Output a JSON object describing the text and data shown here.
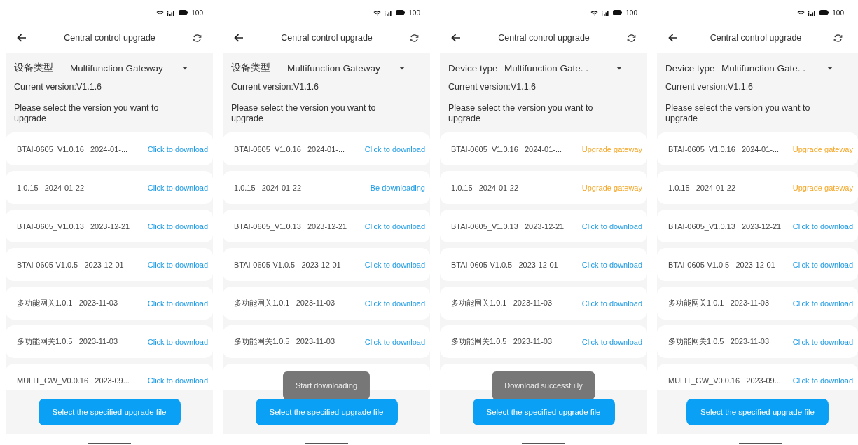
{
  "screens": [
    {
      "status_bar": {
        "battery": "100"
      },
      "title": "Central control upgrade",
      "device_label": "设备类型",
      "device_value": "Multifunction Gateway",
      "current_version": "Current version:V1.1.6",
      "prompt": "Please select the version you want to upgrade",
      "rows": [
        {
          "name": "BTAI-0605_V1.0.16   2024-01-...",
          "action": "Click to download",
          "kind": "download"
        },
        {
          "name": "1.0.15   2024-01-22",
          "action": "Click to download",
          "kind": "download"
        },
        {
          "name": "BTAI-0605_V1.0.13   2023-12-21",
          "action": "Click to download",
          "kind": "download"
        },
        {
          "name": "BTAI-0605-V1.0.5   2023-12-01",
          "action": "Click to download",
          "kind": "download"
        },
        {
          "name": "多功能网关1.0.1   2023-11-03",
          "action": "Click to download",
          "kind": "download"
        },
        {
          "name": "多功能网关1.0.5   2023-11-03",
          "action": "Click to download",
          "kind": "download"
        },
        {
          "name": "MULIT_GW_V0.0.16   2023-09...",
          "action": "Click to download",
          "kind": "download"
        }
      ],
      "button": "Select the specified upgrade file"
    },
    {
      "status_bar": {
        "battery": "100"
      },
      "title": "Central control upgrade",
      "device_label": "设备类型",
      "device_value": "Multifunction Gateway",
      "current_version": "Current version:V1.1.6",
      "prompt": "Please select the version you want to upgrade",
      "rows": [
        {
          "name": "BTAI-0605_V1.0.16   2024-01-...",
          "action": "Click to download",
          "kind": "download"
        },
        {
          "name": "1.0.15   2024-01-22",
          "action": "Be downloading",
          "kind": "download"
        },
        {
          "name": "BTAI-0605_V1.0.13   2023-12-21",
          "action": "Click to download",
          "kind": "download"
        },
        {
          "name": "BTAI-0605-V1.0.5   2023-12-01",
          "action": "Click to download",
          "kind": "download"
        },
        {
          "name": "多功能网关1.0.1   2023-11-03",
          "action": "Click to download",
          "kind": "download"
        },
        {
          "name": "多功能网关1.0.5   2023-11-03",
          "action": "Click to download",
          "kind": "download"
        },
        {
          "kind": "covered"
        }
      ],
      "toast": "Start downloading",
      "button": "Select the specified upgrade file"
    },
    {
      "status_bar": {
        "battery": "100"
      },
      "title": "Central control upgrade",
      "device_label": "Device type",
      "device_value": "Multifunction Gate. .",
      "current_version": "Current version:V1.1.6",
      "prompt": "Please select the version you want to upgrade",
      "rows": [
        {
          "name": "BTAI-0605_V1.0.16   2024-01-...",
          "action": "Upgrade gateway",
          "kind": "upgrade"
        },
        {
          "name": "1.0.15   2024-01-22",
          "action": "Upgrade gateway",
          "kind": "upgrade"
        },
        {
          "name": "BTAI-0605_V1.0.13   2023-12-21",
          "action": "Click to download",
          "kind": "download"
        },
        {
          "name": "BTAI-0605-V1.0.5   2023-12-01",
          "action": "Click to download",
          "kind": "download"
        },
        {
          "name": "多功能网关1.0.1   2023-11-03",
          "action": "Click to download",
          "kind": "download"
        },
        {
          "name": "多功能网关1.0.5   2023-11-03",
          "action": "Click to download",
          "kind": "download"
        },
        {
          "kind": "covered"
        }
      ],
      "toast": "Download successfully",
      "button": "Select the specified upgrade file"
    },
    {
      "status_bar": {
        "battery": "100"
      },
      "title": "Central control upgrade",
      "device_label": "Device type",
      "device_value": "Multifunction Gate. .",
      "current_version": "Current version:V1.1.6",
      "prompt": "Please select the version you want to upgrade",
      "rows": [
        {
          "name": "BTAI-0605_V1.0.16   2024-01-...",
          "action": "Upgrade gateway",
          "kind": "upgrade"
        },
        {
          "name": "1.0.15   2024-01-22",
          "action": "Upgrade gateway",
          "kind": "upgrade"
        },
        {
          "name": "BTAI-0605_V1.0.13   2023-12-21",
          "action": "Click to download",
          "kind": "download"
        },
        {
          "name": "BTAI-0605-V1.0.5   2023-12-01",
          "action": "Click to download",
          "kind": "download"
        },
        {
          "name": "多功能网关1.0.1   2023-11-03",
          "action": "Click to download",
          "kind": "download"
        },
        {
          "name": "多功能网关1.0.5   2023-11-03",
          "action": "Click to download",
          "kind": "download"
        },
        {
          "name": "MULIT_GW_V0.0.16   2023-09...",
          "action": "Click to download",
          "kind": "download"
        }
      ],
      "button": "Select the specified upgrade file"
    }
  ]
}
